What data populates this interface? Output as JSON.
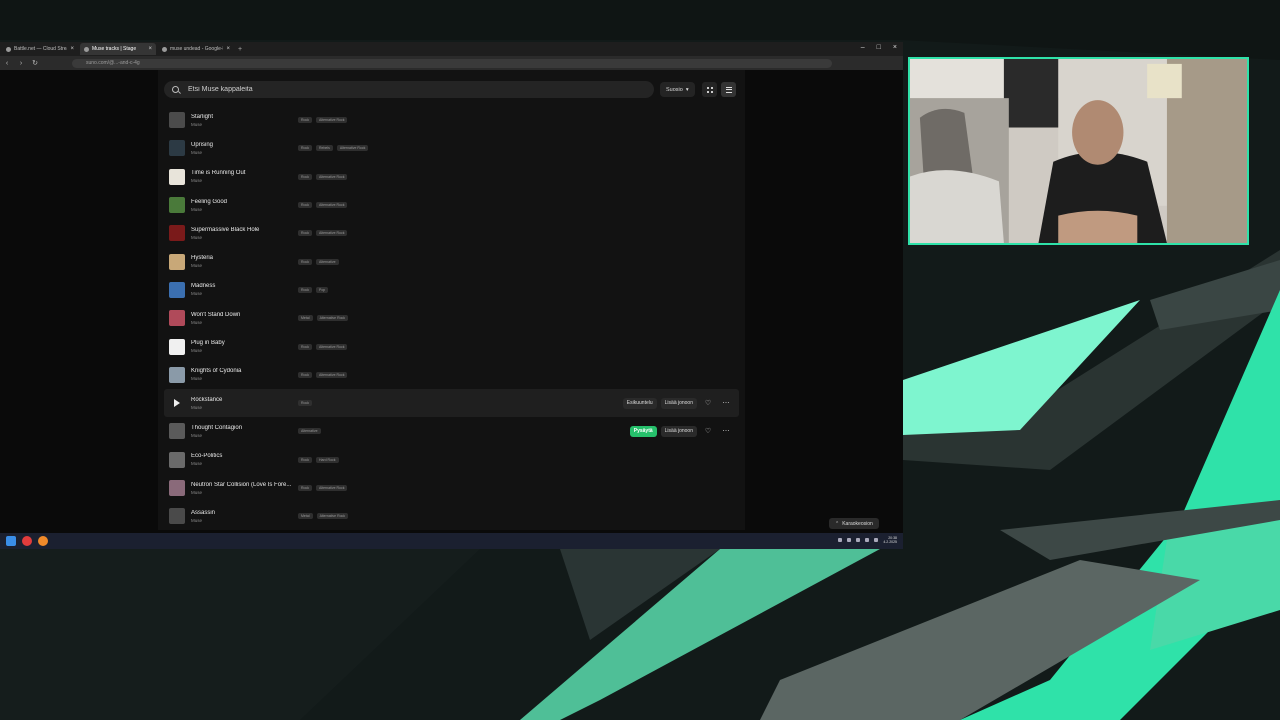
{
  "browser": {
    "tabs": [
      {
        "label": "Battle.net — Cloud Streaming Box",
        "active": false
      },
      {
        "label": "Muse tracks | Stage",
        "active": true
      },
      {
        "label": "muse undead - Google-haku",
        "active": false
      }
    ],
    "url": "suno.com/@...-and-c-4g"
  },
  "search": {
    "placeholder": "Etsi Muse kappaleita"
  },
  "sort_label": "Suosio",
  "tracks": [
    {
      "title": "Starlight",
      "artist": "Muse",
      "tags": [
        "Rock",
        "Alternative Rock"
      ],
      "cover": "#4b4b4b"
    },
    {
      "title": "Uprising",
      "artist": "Muse",
      "tags": [
        "Rock",
        "Rebels",
        "Alternative Rock"
      ],
      "cover": "#2c3a44"
    },
    {
      "title": "Time is Running Out",
      "artist": "Muse",
      "tags": [
        "Rock",
        "Alternative Rock"
      ],
      "cover": "#e8e4da"
    },
    {
      "title": "Feeling Good",
      "artist": "Muse",
      "tags": [
        "Rock",
        "Alternative Rock"
      ],
      "cover": "#4a7a3a"
    },
    {
      "title": "Supermassive Black Hole",
      "artist": "Muse",
      "tags": [
        "Rock",
        "Alternative Rock"
      ],
      "cover": "#7a1a1a"
    },
    {
      "title": "Hysteria",
      "artist": "Muse",
      "tags": [
        "Rock",
        "Alternative"
      ],
      "cover": "#c8a878"
    },
    {
      "title": "Madness",
      "artist": "Muse",
      "tags": [
        "Rock",
        "Pop"
      ],
      "cover": "#3b6fb0"
    },
    {
      "title": "Won't Stand Down",
      "artist": "Muse",
      "tags": [
        "Metal",
        "Alternative Rock"
      ],
      "cover": "#b04a5a"
    },
    {
      "title": "Plug in Baby",
      "artist": "Muse",
      "tags": [
        "Rock",
        "Alternative Rock"
      ],
      "cover": "#f0f0f0"
    },
    {
      "title": "Knights of Cydonia",
      "artist": "Muse",
      "tags": [
        "Rock",
        "Alternative Rock"
      ],
      "cover": "#8a9aa8"
    },
    {
      "title": "Rockstance",
      "artist": "Muse",
      "tags": [
        "Rock"
      ],
      "cover": "#1a1a1a",
      "hover": true
    },
    {
      "title": "Thought Contagion",
      "artist": "Muse",
      "tags": [
        "Alternative"
      ],
      "cover": "#5a5a5a"
    },
    {
      "title": "Eco-Politics",
      "artist": "Muse",
      "tags": [
        "Rock",
        "Hard Rock"
      ],
      "cover": "#6a6a6a"
    },
    {
      "title": "Neutron Star Collision (Love Is Fore...",
      "artist": "Muse",
      "tags": [
        "Rock",
        "Alternative Rock"
      ],
      "cover": "#8a6a7a"
    },
    {
      "title": "Assassin",
      "artist": "Muse",
      "tags": [
        "Metal",
        "Alternative Rock"
      ],
      "cover": "#4a4a4a"
    }
  ],
  "row_actions": {
    "hover_row": {
      "primary": "Esikuuntelu",
      "secondary": "Lisää jonoon"
    },
    "selected_row": {
      "primary": "Pysäytä",
      "secondary": "Lisää jonoon"
    }
  },
  "karaoke_label": "Karaokeosion",
  "taskbar": {
    "time": "20:38",
    "date": "4.2.2025"
  },
  "colors": {
    "accent": "#2fe2a9",
    "play_green": "#26c06b"
  }
}
